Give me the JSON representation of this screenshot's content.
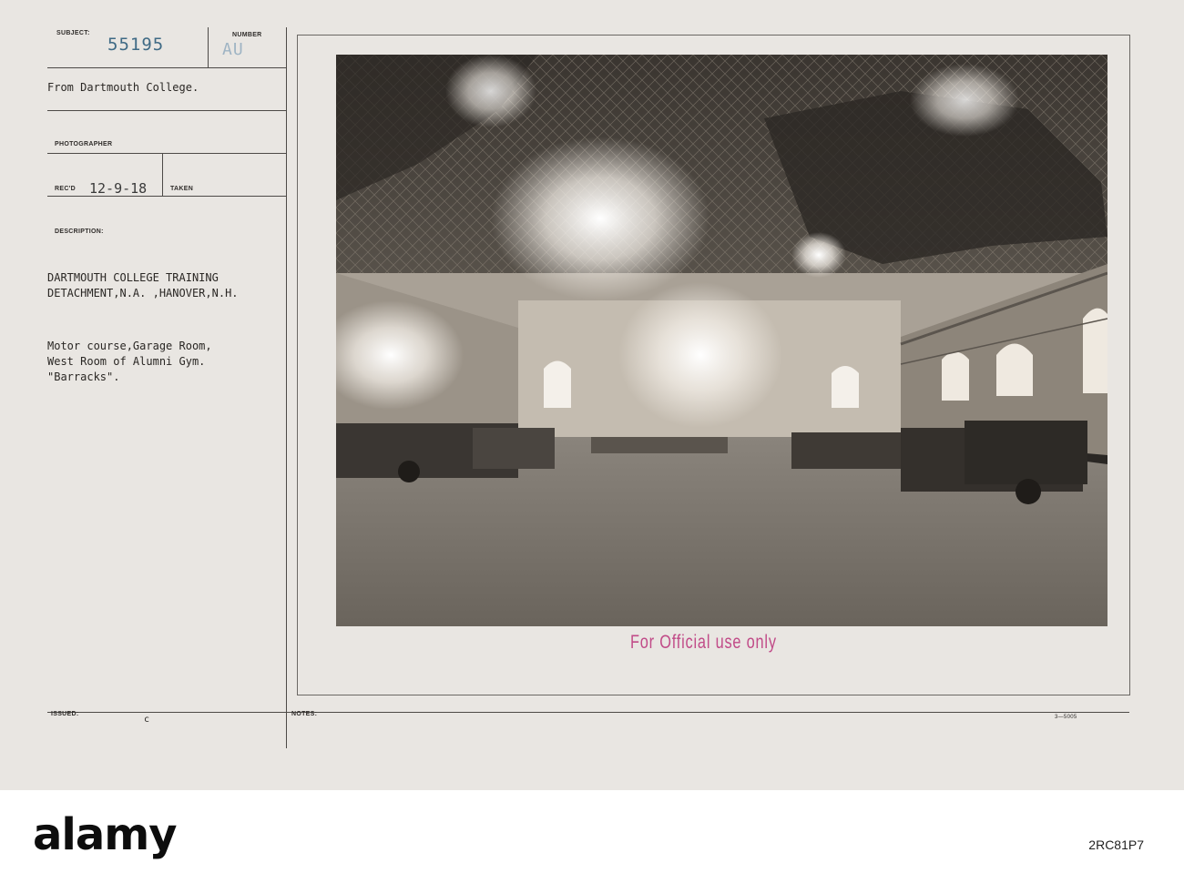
{
  "card": {
    "labels": {
      "subject": "SUBJECT:",
      "number": "NUMBER",
      "photographer": "PHOTOGRAPHER",
      "recd": "REC'D",
      "taken": "TAKEN",
      "description": "DESCRIPTION:",
      "issued": "ISSUED:",
      "notes": "NOTES:"
    },
    "subject_number": "55195",
    "number_value": "AU",
    "from_line": "From Dartmouth College.",
    "recd_date": "12-9-18",
    "description_lines": [
      "DARTMOUTH COLLEGE TRAINING",
      "DETACHMENT,N.A. ,HANOVER,N.H."
    ],
    "caption_lines": [
      "Motor course,Garage Room,",
      "West Room of Alumni Gym.",
      "\"Barracks\"."
    ],
    "issued_value": "c",
    "form_number": "3—5005",
    "stamp": "For Official use only"
  },
  "watermark": {
    "brand": "alamy",
    "image_id": "2RC81P7"
  }
}
